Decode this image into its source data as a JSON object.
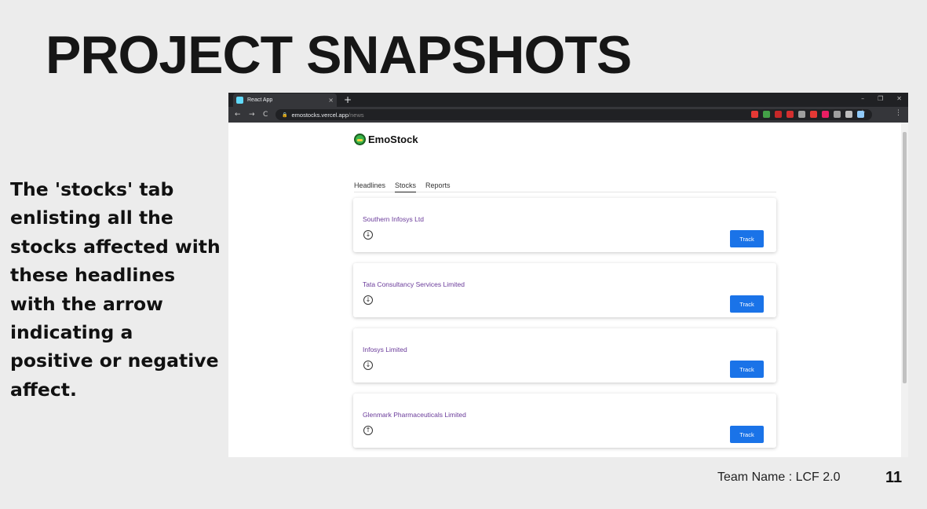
{
  "slide": {
    "title": "PROJECT SNAPSHOTS",
    "caption": "The 'stocks' tab enlisting all the stocks affected with these headlines with the arrow indicating a positive or negative affect.",
    "team": "Team Name : LCF 2.0",
    "page_number": "11"
  },
  "browser": {
    "tab_title": "React App",
    "tab_close": "×",
    "new_tab": "+",
    "win_min": "–",
    "win_max": "❐",
    "win_close": "✕",
    "back": "←",
    "forward": "→",
    "reload": "C",
    "url_host": "emostocks.vercel.app",
    "url_path": "/news",
    "star": "☆",
    "menu": "⋮",
    "extension_colors": [
      "#e53935",
      "#43a047",
      "#c62828",
      "#d32f2f",
      "#9e9e9e",
      "#e53935",
      "#e91e63",
      "#9e9e9e",
      "#bdbdbd",
      "#90caf9"
    ]
  },
  "app": {
    "brand": "EmoStock",
    "tabs": [
      "Headlines",
      "Stocks",
      "Reports"
    ],
    "active_tab": "Stocks",
    "track_label": "Track",
    "stocks": [
      {
        "name": "Southern Infosys Ltd",
        "direction": "down",
        "arrow": "↓"
      },
      {
        "name": "Tata Consultancy Services Limited",
        "direction": "down",
        "arrow": "↓"
      },
      {
        "name": "Infosys Limited",
        "direction": "down",
        "arrow": "↓"
      },
      {
        "name": "Glenmark Pharmaceuticals Limited",
        "direction": "up",
        "arrow": "↑"
      }
    ]
  }
}
